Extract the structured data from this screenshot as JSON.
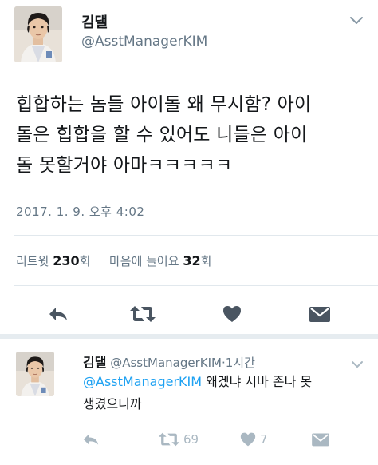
{
  "tweet": {
    "author": {
      "name": "김댈",
      "handle": "@AsstManagerKIM",
      "avatar_icon": "profile-photo"
    },
    "text_lines": [
      "힙합하는 놈들 아이돌 왜 무시함? 아이",
      "돌은 힙합을 할 수 있어도 니들은 아이",
      "돌 못할거야 아마ㅋㅋㅋㅋㅋ"
    ],
    "timestamp": "2017. 1. 9. 오후 4:02",
    "stats": {
      "retweets_label": "리트윗",
      "retweets_count": "230",
      "retweets_suffix": "회",
      "likes_label": "마음에 들어요",
      "likes_count": "32",
      "likes_suffix": "회"
    },
    "actions": [
      "reply-icon",
      "retweet-icon",
      "heart-icon",
      "message-icon"
    ]
  },
  "reply": {
    "author": {
      "name": "김댈",
      "handle": "@AsstManagerKIM",
      "separator": "·",
      "time": "1시간"
    },
    "mention": "@AsstManagerKIM",
    "text_rest": " 왜겠냐 시바 존나 못",
    "text_line2": "생겼으니까",
    "retweet_count": "69",
    "like_count": "7"
  },
  "colors": {
    "text": "#14171a",
    "secondary": "#657786",
    "icon_dark": "#4a5561",
    "icon_light": "#aab8c2",
    "link": "#1da1f2",
    "divider": "#e1e8ed"
  }
}
